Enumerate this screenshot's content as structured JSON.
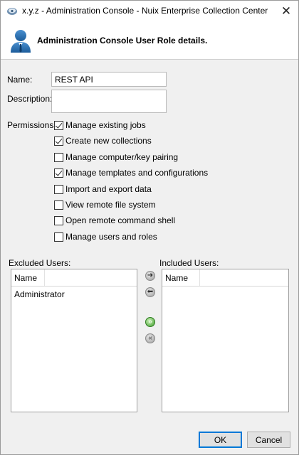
{
  "window": {
    "title": "x.y.z - Administration Console - Nuix Enterprise Collection Center",
    "close_glyph": "✕"
  },
  "header": {
    "title": "Administration Console User Role details.",
    "icon": "user-icon"
  },
  "form": {
    "name_label": "Name:",
    "name_value": "REST API",
    "description_label": "Description:",
    "description_value": "",
    "permissions_label": "Permissions:"
  },
  "permissions": [
    {
      "label": "Manage existing jobs",
      "checked": true
    },
    {
      "label": "Create new collections",
      "checked": true
    },
    {
      "label": "Manage computer/key pairing",
      "checked": false
    },
    {
      "label": "Manage templates and configurations",
      "checked": true
    },
    {
      "label": "Import and export data",
      "checked": false
    },
    {
      "label": "View remote file system",
      "checked": false
    },
    {
      "label": "Open remote command shell",
      "checked": false
    },
    {
      "label": "Manage users and roles",
      "checked": false
    }
  ],
  "excluded": {
    "label": "Excluded Users:",
    "column": "Name",
    "items": [
      "Administrator"
    ]
  },
  "included": {
    "label": "Included Users:",
    "column": "Name",
    "items": []
  },
  "transfer_buttons": [
    {
      "icon": "arrow-right-icon",
      "glyph": "➜"
    },
    {
      "icon": "arrow-left-icon",
      "glyph": "⬅"
    },
    {
      "icon": "move-all-right-icon",
      "glyph": "»"
    },
    {
      "icon": "move-all-left-icon",
      "glyph": "«"
    }
  ],
  "buttons": {
    "ok": "OK",
    "cancel": "Cancel"
  },
  "colors": {
    "dialog_bg": "#f0f0f0",
    "default_button_border": "#0078d7",
    "add_all_green": "#3f9d2c"
  }
}
